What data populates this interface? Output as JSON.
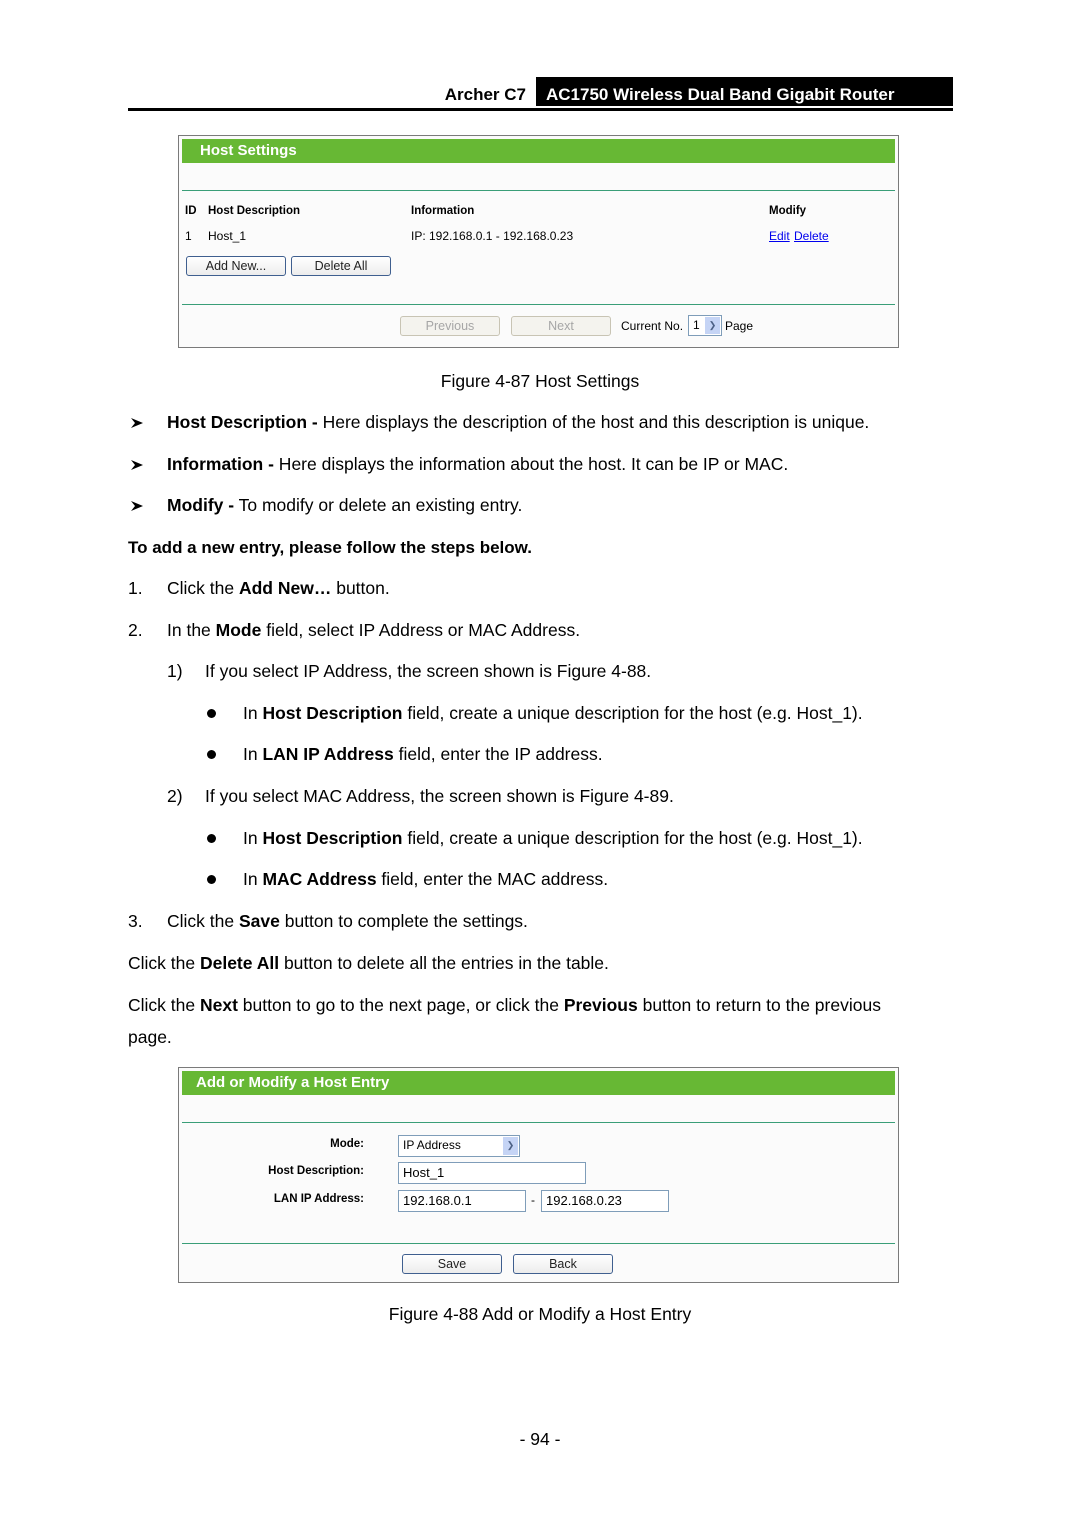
{
  "header": {
    "model": "Archer C7",
    "product": "AC1750 Wireless Dual Band Gigabit Router"
  },
  "figure87": {
    "panel_title": "Host Settings",
    "columns": [
      "ID",
      "Host Description",
      "Information",
      "Modify"
    ],
    "rows": [
      {
        "id": "1",
        "description": "Host_1",
        "information": "IP: 192.168.0.1 - 192.168.0.23",
        "edit": "Edit",
        "delete": "Delete"
      }
    ],
    "add_new_label": "Add New...",
    "delete_all_label": "Delete All",
    "previous_label": "Previous",
    "next_label": "Next",
    "current_no_label": "Current No.",
    "current_page": "1",
    "page_label": "Page",
    "caption": "Figure 4-87 Host Settings"
  },
  "descriptions": [
    {
      "term": "Host Description -",
      "text": " Here displays the description of the host and this description is unique."
    },
    {
      "term": "Information -",
      "text": " Here displays the information about the host. It can be IP or MAC."
    },
    {
      "term": "Modify -",
      "text": " To modify or delete an existing entry."
    }
  ],
  "steps_heading": "To add a new entry, please follow the steps below.",
  "steps": {
    "s1": {
      "num": "1.",
      "pre": "Click the ",
      "bold": "Add New…",
      "post": " button."
    },
    "s2": {
      "num": "2.",
      "pre": "In the ",
      "bold": "Mode",
      "post": " field, select IP Address or MAC Address."
    },
    "s2_1": {
      "num": "1)",
      "text": "If you select IP Address, the screen shown is Figure 4-88."
    },
    "s2_1_a": {
      "pre": "In ",
      "bold": "Host Description",
      "post": " field, create a unique description for the host (e.g. Host_1)."
    },
    "s2_1_b": {
      "pre": "In ",
      "bold": "LAN IP Address",
      "post": " field, enter the IP address."
    },
    "s2_2": {
      "num": "2)",
      "text": "If you select MAC Address, the screen shown is Figure 4-89."
    },
    "s2_2_a": {
      "pre": "In ",
      "bold": "Host Description",
      "post": " field, create a unique description for the host (e.g. Host_1)."
    },
    "s2_2_b": {
      "pre": "In ",
      "bold": "MAC Address",
      "post": " field, enter the MAC address."
    },
    "s3": {
      "num": "3.",
      "pre": "Click the ",
      "bold": "Save",
      "post": " button to complete the settings."
    }
  },
  "para_delete_all": {
    "pre": "Click the ",
    "bold": "Delete All",
    "post": " button to delete all the entries in the table."
  },
  "para_next": {
    "pre": "Click the ",
    "bold1": "Next",
    "mid": " button to go to the next page, or click the ",
    "bold2": "Previous",
    "post": " button to return to the previous",
    "line2": "page."
  },
  "figure88": {
    "panel_title": "Add or Modify a Host Entry",
    "mode_label": "Mode:",
    "mode_value": "IP Address",
    "host_desc_label": "Host Description:",
    "host_desc_value": "Host_1",
    "lan_ip_label": "LAN IP Address:",
    "lan_ip_start": "192.168.0.1",
    "range_sep": "-",
    "lan_ip_end": "192.168.0.23",
    "save_label": "Save",
    "back_label": "Back",
    "caption": "Figure 4-88 Add or Modify a Host Entry"
  },
  "page_number": "- 94 -"
}
